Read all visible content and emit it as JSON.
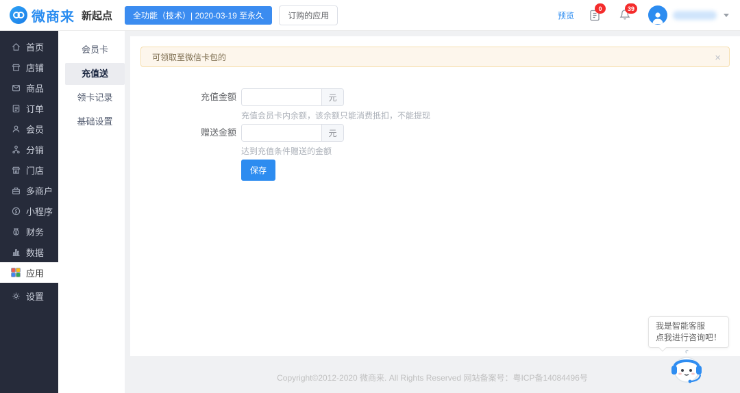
{
  "header": {
    "logo_text": "微商来",
    "workspace_name": "新起点",
    "plan_badge": "全功能（技术）| 2020-03-19 至永久",
    "ordered_apps_button": "订购的应用",
    "preview_link": "预览",
    "orders_badge_count": "0",
    "notifications_badge_count": "39"
  },
  "sidebar": {
    "items": [
      {
        "label": "首页",
        "icon": "home-icon"
      },
      {
        "label": "店铺",
        "icon": "shop-icon"
      },
      {
        "label": "商品",
        "icon": "goods-icon"
      },
      {
        "label": "订单",
        "icon": "orders-icon"
      },
      {
        "label": "会员",
        "icon": "member-icon"
      },
      {
        "label": "分销",
        "icon": "distribution-icon"
      },
      {
        "label": "门店",
        "icon": "store-icon"
      },
      {
        "label": "多商户",
        "icon": "multi-merchant-icon"
      },
      {
        "label": "小程序",
        "icon": "miniprogram-icon"
      },
      {
        "label": "财务",
        "icon": "finance-icon"
      },
      {
        "label": "数据",
        "icon": "data-icon"
      },
      {
        "label": "应用",
        "icon": "apps-icon",
        "active": true
      },
      {
        "label": "设置",
        "icon": "settings-icon"
      }
    ]
  },
  "submenu": {
    "items": [
      {
        "label": "会员卡"
      },
      {
        "label": "充值送",
        "active": true
      },
      {
        "label": "领卡记录"
      },
      {
        "label": "基础设置"
      }
    ]
  },
  "notice": {
    "text": "可领取至微信卡包的",
    "close": "×"
  },
  "form": {
    "recharge": {
      "label": "充值金额",
      "value": "",
      "unit": "元",
      "help": "充值会员卡内余额，该余额只能消费抵扣，不能提现"
    },
    "gift": {
      "label": "赠送金额",
      "value": "",
      "unit": "元",
      "help": "达到充值条件赠送的金额"
    },
    "save_button": "保存"
  },
  "chat": {
    "line1": "我是智能客服",
    "line2": "点我进行咨询吧！"
  },
  "footer": {
    "copyright": "Copyright©2012-2020 微商来. All Rights Reserved 网站备案号：粤ICP备14084496号"
  },
  "colors": {
    "primary_blue": "#2d8cf0",
    "sidebar_bg": "#262b3a",
    "badge_red": "#f42c2c",
    "notice_bg": "#fdf6ec",
    "page_bg": "#f0f1f3"
  }
}
